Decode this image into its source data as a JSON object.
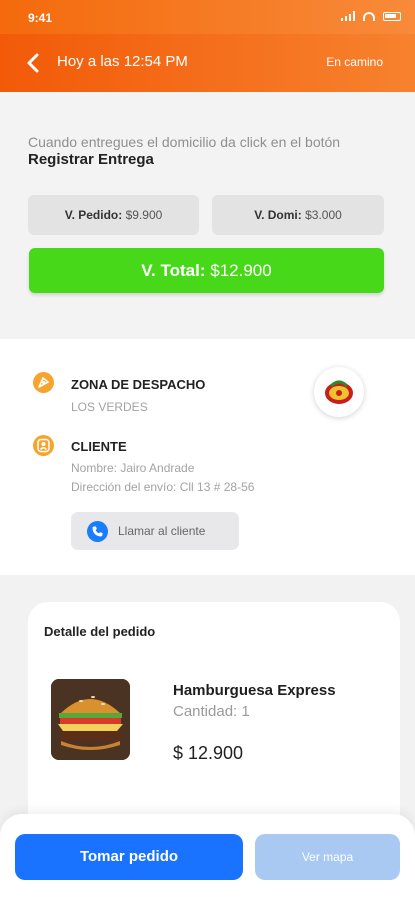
{
  "status_bar": {
    "time": "9:41"
  },
  "header": {
    "title": "Hoy a las 12:54 PM",
    "status": "En camino"
  },
  "instructions": {
    "line1": "Cuando entregues el domicilio da click en el botón",
    "line2": "Registrar Entrega"
  },
  "values": {
    "pedido_label": "V. Pedido:",
    "pedido_value": "$9.900",
    "domi_label": "V. Domi:",
    "domi_value": "$3.000",
    "total_label": "V. Total:",
    "total_value": "$12.900"
  },
  "zone": {
    "title": "ZONA DE DESPACHO",
    "name": "LOS VERDES"
  },
  "client": {
    "title": "CLIENTE",
    "name": "Nombre: Jairo Andrade",
    "address": "Dirección del envío: Cll 13 # 28-56",
    "call_label": "Llamar al cliente"
  },
  "order": {
    "title": "Detalle del pedido",
    "items": [
      {
        "name": "Hamburguesa Express",
        "quantity": "Cantidad: 1",
        "price": "$ 12.900"
      }
    ]
  },
  "actions": {
    "take_order": "Tomar pedido",
    "view_map": "Ver mapa"
  },
  "colors": {
    "header": "#f25a08",
    "total_button": "#47d81a",
    "primary": "#1a73ff",
    "secondary_disabled": "#a9c9f2",
    "accent_icon": "#f7a42f"
  },
  "icons": [
    "back-icon",
    "signal-icon",
    "wifi-icon",
    "battery-icon",
    "dispatch-zone-icon",
    "client-icon",
    "phone-icon",
    "restaurant-logo"
  ]
}
